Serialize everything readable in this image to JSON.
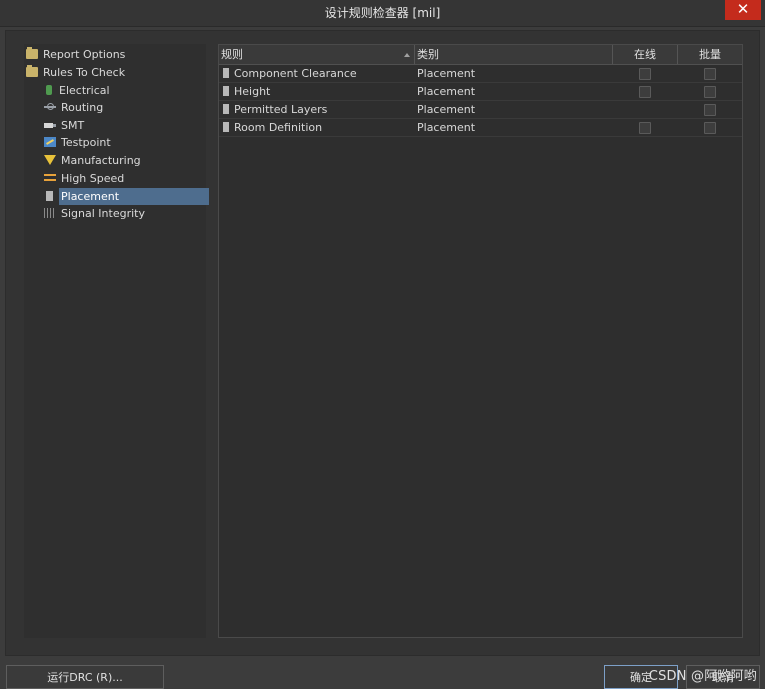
{
  "window": {
    "title": "设计规则检查器 [mil]",
    "close_symbol": "✕"
  },
  "tree": [
    {
      "label": "Report Options",
      "icon": "folder-icon",
      "level": 0
    },
    {
      "label": "Rules To Check",
      "icon": "folder-icon",
      "level": 0
    },
    {
      "label": "Electrical",
      "icon": "electrical-icon",
      "level": 1
    },
    {
      "label": "Routing",
      "icon": "routing-icon",
      "level": 1
    },
    {
      "label": "SMT",
      "icon": "smt-icon",
      "level": 1
    },
    {
      "label": "Testpoint",
      "icon": "testpoint-icon",
      "level": 1
    },
    {
      "label": "Manufacturing",
      "icon": "manufacturing-icon",
      "level": 1
    },
    {
      "label": "High Speed",
      "icon": "high-speed-icon",
      "level": 1
    },
    {
      "label": "Placement",
      "icon": "placement-icon",
      "level": 1,
      "selected": true
    },
    {
      "label": "Signal Integrity",
      "icon": "signal-integrity-icon",
      "level": 1
    }
  ],
  "grid": {
    "headers": {
      "rule": "规则",
      "category": "类别",
      "online": "在线",
      "batch": "批量"
    },
    "rows": [
      {
        "rule": "Component Clearance",
        "category": "Placement",
        "online": false,
        "batch": false
      },
      {
        "rule": "Height",
        "category": "Placement",
        "online": false,
        "batch": false
      },
      {
        "rule": "Permitted Layers",
        "category": "Placement",
        "online": null,
        "batch": false
      },
      {
        "rule": "Room Definition",
        "category": "Placement",
        "online": false,
        "batch": false
      }
    ]
  },
  "footer": {
    "run_drc_label": "运行DRC (R)...",
    "ok_label": "确定",
    "cancel_label": "取消"
  },
  "watermark": "CSDN @阿哟阿哟",
  "colors": {
    "background": "#3c3c3c",
    "selection": "#4e6d8e",
    "close_button": "#c42b1c"
  }
}
